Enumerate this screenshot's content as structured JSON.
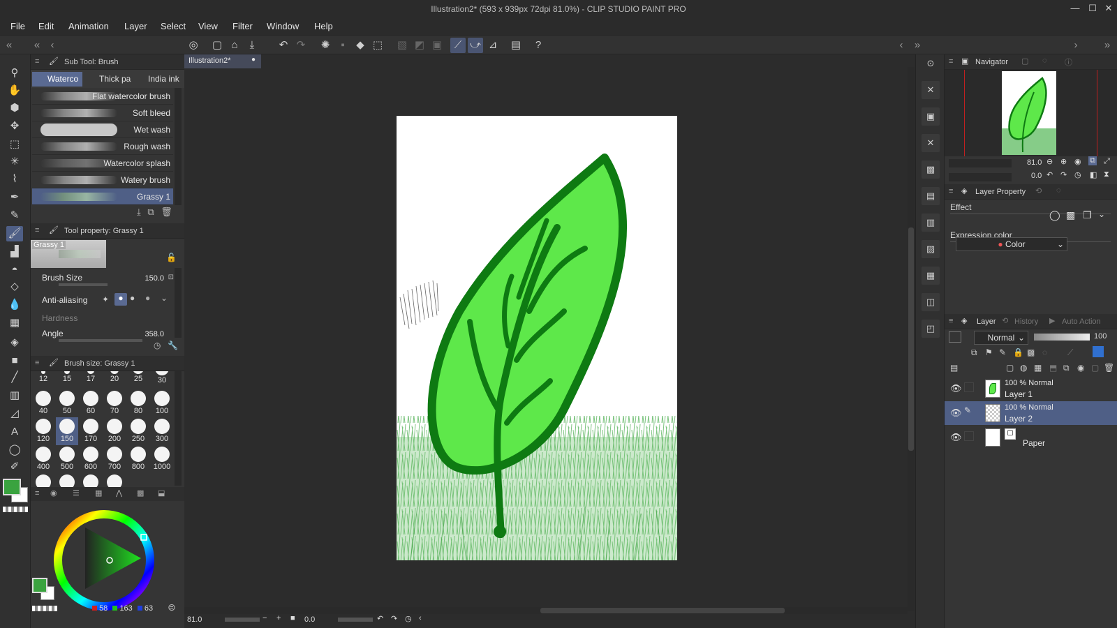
{
  "window": {
    "title": "Illustration2* (593 x 939px 72dpi 81.0%)  - CLIP STUDIO PAINT PRO",
    "min": "—",
    "max": "☐",
    "close": "✕"
  },
  "menu": [
    "File",
    "Edit",
    "Animation",
    "Layer",
    "Select",
    "View",
    "Filter",
    "Window",
    "Help"
  ],
  "subtool": {
    "header": "Sub Tool: Brush",
    "tabs": [
      "Waterco",
      "Thick pa",
      "India ink"
    ],
    "brushes": [
      "Flat watercolor brush",
      "Soft bleed",
      "Wet wash",
      "Rough wash",
      "Watercolor splash",
      "Watery brush",
      "Grassy 1"
    ],
    "selected": "Grassy 1"
  },
  "tool_property": {
    "header": "Tool property: Grassy 1",
    "preview_name": "Grassy 1",
    "brush_size_label": "Brush Size",
    "brush_size_value": "150.0",
    "antialias_label": "Anti-aliasing",
    "hardness_label": "Hardness",
    "angle_label": "Angle",
    "angle_value": "358.0"
  },
  "brush_size_palette": {
    "header": "Brush size: Grassy 1",
    "sizes": [
      "12",
      "15",
      "17",
      "20",
      "25",
      "30",
      "40",
      "50",
      "60",
      "70",
      "80",
      "100",
      "120",
      "150",
      "170",
      "200",
      "250",
      "300",
      "400",
      "500",
      "600",
      "700",
      "800",
      "1000"
    ],
    "selected": "150"
  },
  "colors": {
    "main": "#3aa33f",
    "sub": "#ffffff",
    "r": "58",
    "g": "163",
    "b": "63",
    "accent": "#4f5f86"
  },
  "document": {
    "tab": "Illustration2*",
    "zoom": "81.0",
    "rotation": "0.0"
  },
  "navigator": {
    "header": "Navigator",
    "zoom": "81.0",
    "rotation": "0.0"
  },
  "layer_property": {
    "header": "Layer Property",
    "effect_label": "Effect",
    "expression_label": "Expression color",
    "expression_value": "Color"
  },
  "layer_panel": {
    "tabs": [
      "Layer",
      "History",
      "Auto Action"
    ],
    "blend_mode": "Normal",
    "opacity": "100",
    "layers": [
      {
        "info": "100 % Normal",
        "name": "Layer 1"
      },
      {
        "info": "100 % Normal",
        "name": "Layer 2"
      },
      {
        "info": "",
        "name": "Paper"
      }
    ]
  }
}
